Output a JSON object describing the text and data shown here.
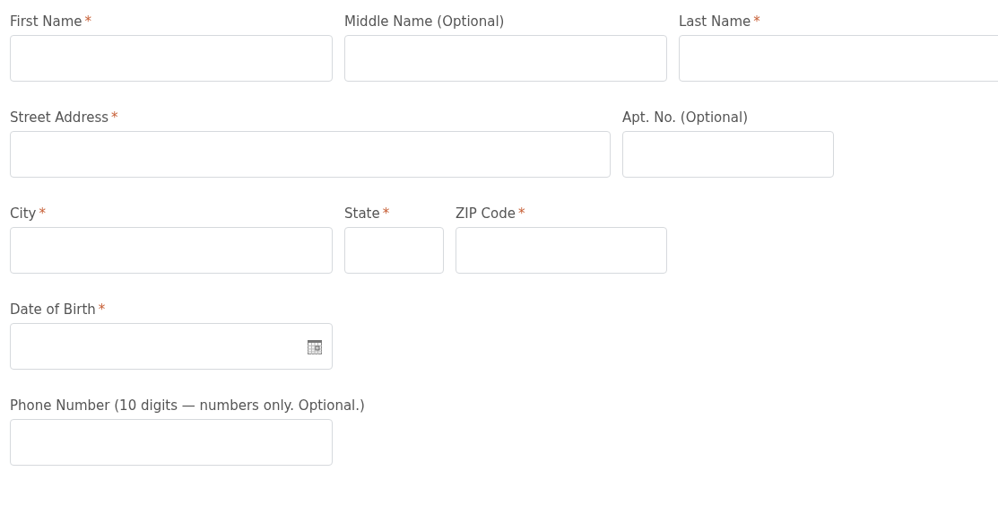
{
  "rows": [
    {
      "fields": [
        {
          "label": "First Name",
          "required_mark": "*",
          "kind": "text"
        },
        {
          "label": "Middle Name (Optional)",
          "kind": "text"
        },
        {
          "label": "Last Name",
          "required_mark": "*",
          "kind": "text"
        }
      ]
    },
    {
      "fields": [
        {
          "label": "Street Address",
          "required_mark": "*",
          "kind": "text"
        },
        {
          "label": "Apt. No. (Optional)",
          "kind": "text"
        }
      ]
    },
    {
      "fields": [
        {
          "label": "City",
          "required_mark": "*",
          "kind": "text"
        },
        {
          "label": "State",
          "required_mark": "*",
          "kind": "text"
        },
        {
          "label": "ZIP Code",
          "required_mark": "*",
          "kind": "text"
        }
      ]
    },
    {
      "fields": [
        {
          "label": "Date of Birth",
          "required_mark": "*",
          "kind": "date"
        }
      ]
    },
    {
      "fields": [
        {
          "label": "Phone Number (10 digits — numbers only. Optional.)",
          "kind": "text"
        }
      ]
    }
  ]
}
